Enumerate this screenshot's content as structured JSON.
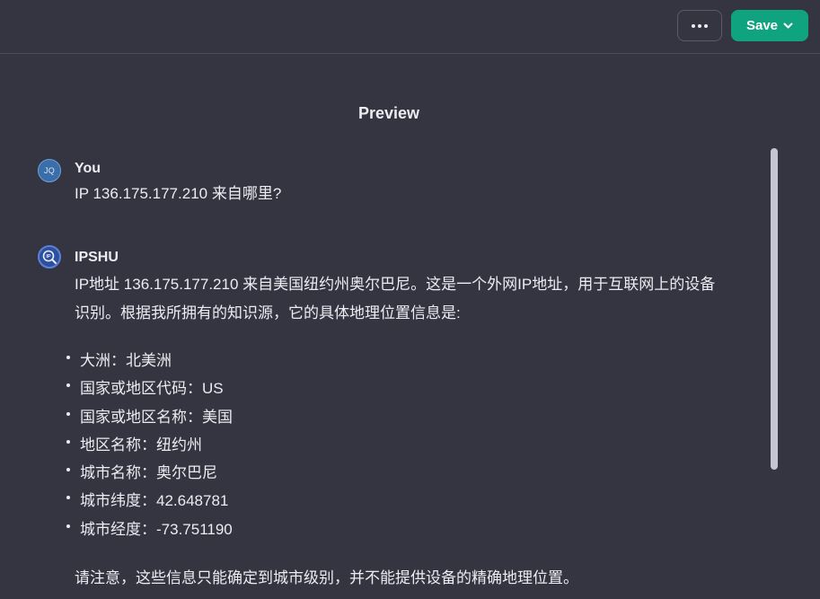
{
  "header": {
    "more_label": "More options",
    "save_label": "Save"
  },
  "preview": {
    "title": "Preview"
  },
  "user_message": {
    "avatar_initials": "JQ",
    "sender": "You",
    "text": "IP 136.175.177.210 来自哪里?"
  },
  "bot_message": {
    "avatar_icon": "ip-magnifier-icon",
    "sender": "IPSHU",
    "intro_line1": "IP地址 136.175.177.210 来自美国纽约州奥尔巴尼。这是一个外网IP地址，用于互联网上的设备",
    "intro_line2": "识别。根据我所拥有的知识源，它的具体地理位置信息是:",
    "items": [
      "大洲：北美洲",
      "国家或地区代码：US",
      "国家或地区名称：美国",
      "地区名称：纽约州",
      "城市名称：奥尔巴尼",
      "城市纬度：42.648781",
      "城市经度：-73.751190"
    ],
    "note": "请注意，这些信息只能确定到城市级别，并不能提供设备的精确地理位置。"
  },
  "colors": {
    "background": "#343541",
    "accent": "#10a37f",
    "text": "#ececf1",
    "scrollbar": "#c5c5d2"
  }
}
